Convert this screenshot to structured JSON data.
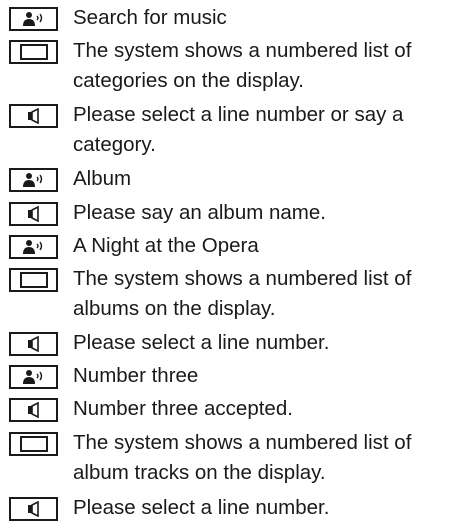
{
  "dialog": [
    {
      "speaker": "user",
      "icon": "voice-command-icon",
      "text": "Search for music"
    },
    {
      "speaker": "display",
      "icon": "display-icon",
      "text": "The system shows a numbered list of categories on the display."
    },
    {
      "speaker": "system",
      "icon": "speaker-icon",
      "text": "Please select a line number or say a category."
    },
    {
      "speaker": "user",
      "icon": "voice-command-icon",
      "text": "Album"
    },
    {
      "speaker": "system",
      "icon": "speaker-icon",
      "text": "Please say an album name."
    },
    {
      "speaker": "user",
      "icon": "voice-command-icon",
      "text": "A Night at the Opera"
    },
    {
      "speaker": "display",
      "icon": "display-icon",
      "text": "The system shows a numbered list of albums on the display."
    },
    {
      "speaker": "system",
      "icon": "speaker-icon",
      "text": "Please select a line number."
    },
    {
      "speaker": "user",
      "icon": "voice-command-icon",
      "text": "Number three"
    },
    {
      "speaker": "system",
      "icon": "speaker-icon",
      "text": "Number three accepted."
    },
    {
      "speaker": "display",
      "icon": "display-icon",
      "text": "The system shows a numbered list of album tracks on the display."
    },
    {
      "speaker": "system",
      "icon": "speaker-icon",
      "text": "Please select a line number."
    }
  ]
}
